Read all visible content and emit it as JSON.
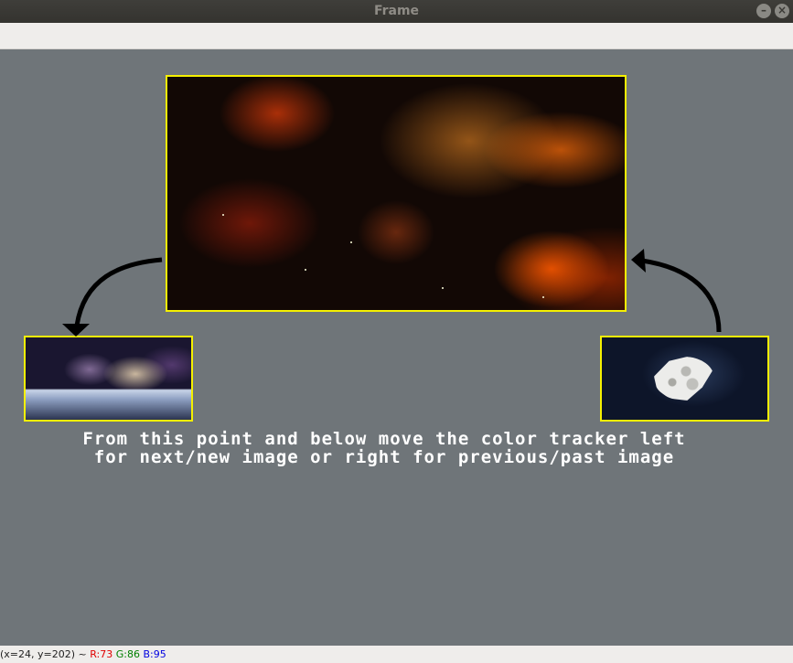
{
  "window": {
    "title": "Frame"
  },
  "caption": {
    "line1": "From this point and below move the color tracker left",
    "line2": "for next/new image or right for previous/past image"
  },
  "status": {
    "coords": "(x=24, y=202) ~",
    "r": "R:73",
    "g": "G:86",
    "b": "B:95",
    "r_color": "#e00000",
    "g_color": "#007f00",
    "b_color": "#0000e0"
  },
  "images": {
    "main": "orange nebula space image",
    "next": "galaxy over planet horizon image",
    "previous": "moon on dark blue sky image"
  },
  "icons": {
    "left_arrow": "curved-arrow-left-down-icon",
    "right_arrow": "curved-arrow-right-up-icon"
  },
  "colors": {
    "frame_border": "#f5f000",
    "canvas_bg": "#6f7579"
  }
}
